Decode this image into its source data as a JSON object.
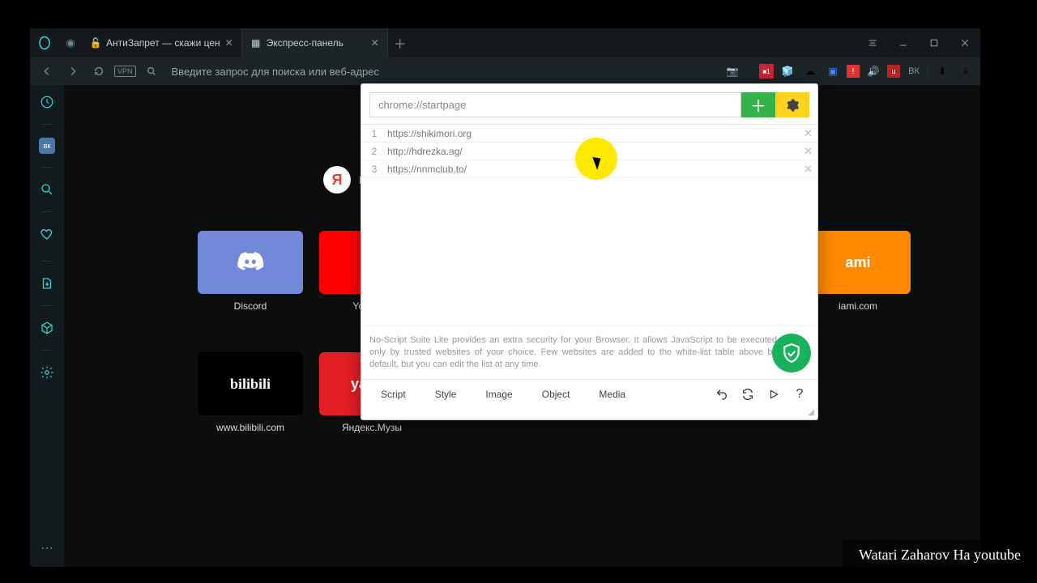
{
  "tabs": [
    {
      "title": "АнтиЗапрет — скажи цен",
      "active": false
    },
    {
      "title": "Экспресс-панель",
      "active": true
    }
  ],
  "address_placeholder": "Введите запрос для поиска или веб-адрес",
  "vpn_label": "VPN",
  "search": {
    "yandex_letter": "Я",
    "label": "Найти"
  },
  "speed_dials": [
    {
      "label": "Discord",
      "tile_class": "tile-discord"
    },
    {
      "label": "YouTube",
      "tile_class": "tile-yt"
    },
    {
      "label": "",
      "tile_class": ""
    },
    {
      "label": "",
      "tile_class": ""
    },
    {
      "label": "",
      "tile_class": ""
    },
    {
      "label": "iami.com",
      "tile_class": "tile-okami",
      "text": "ami"
    },
    {
      "label": "www.bilibili.com",
      "tile_class": "tile-bili",
      "text": "bilibili"
    },
    {
      "label": "Яндекс.Музы",
      "tile_class": "tile-yandex",
      "text": "yande"
    }
  ],
  "popup": {
    "input_value": "chrome://startpage",
    "rows": [
      {
        "n": "1",
        "url": "https://shikimori.org"
      },
      {
        "n": "2",
        "url": "http://hdrezka.ag/"
      },
      {
        "n": "3",
        "url": "https://nnmclub.to/"
      }
    ],
    "desc": "No-Script Suite Lite provides an extra security for your Browser. It allows JavaScript to be executed only by trusted websites of your choice. Few websites are added to the white-list table above by default, but you can edit the list at any time.",
    "tabs": [
      "Script",
      "Style",
      "Image",
      "Object",
      "Media"
    ]
  },
  "ext_icons": [
    "📷",
    "🟥",
    "🧊",
    "☁",
    "🔤",
    "🛑",
    "🔊",
    "🟥",
    "ВК",
    "⬇",
    "≡"
  ],
  "watermark": "Watari Zaharov На youtube"
}
